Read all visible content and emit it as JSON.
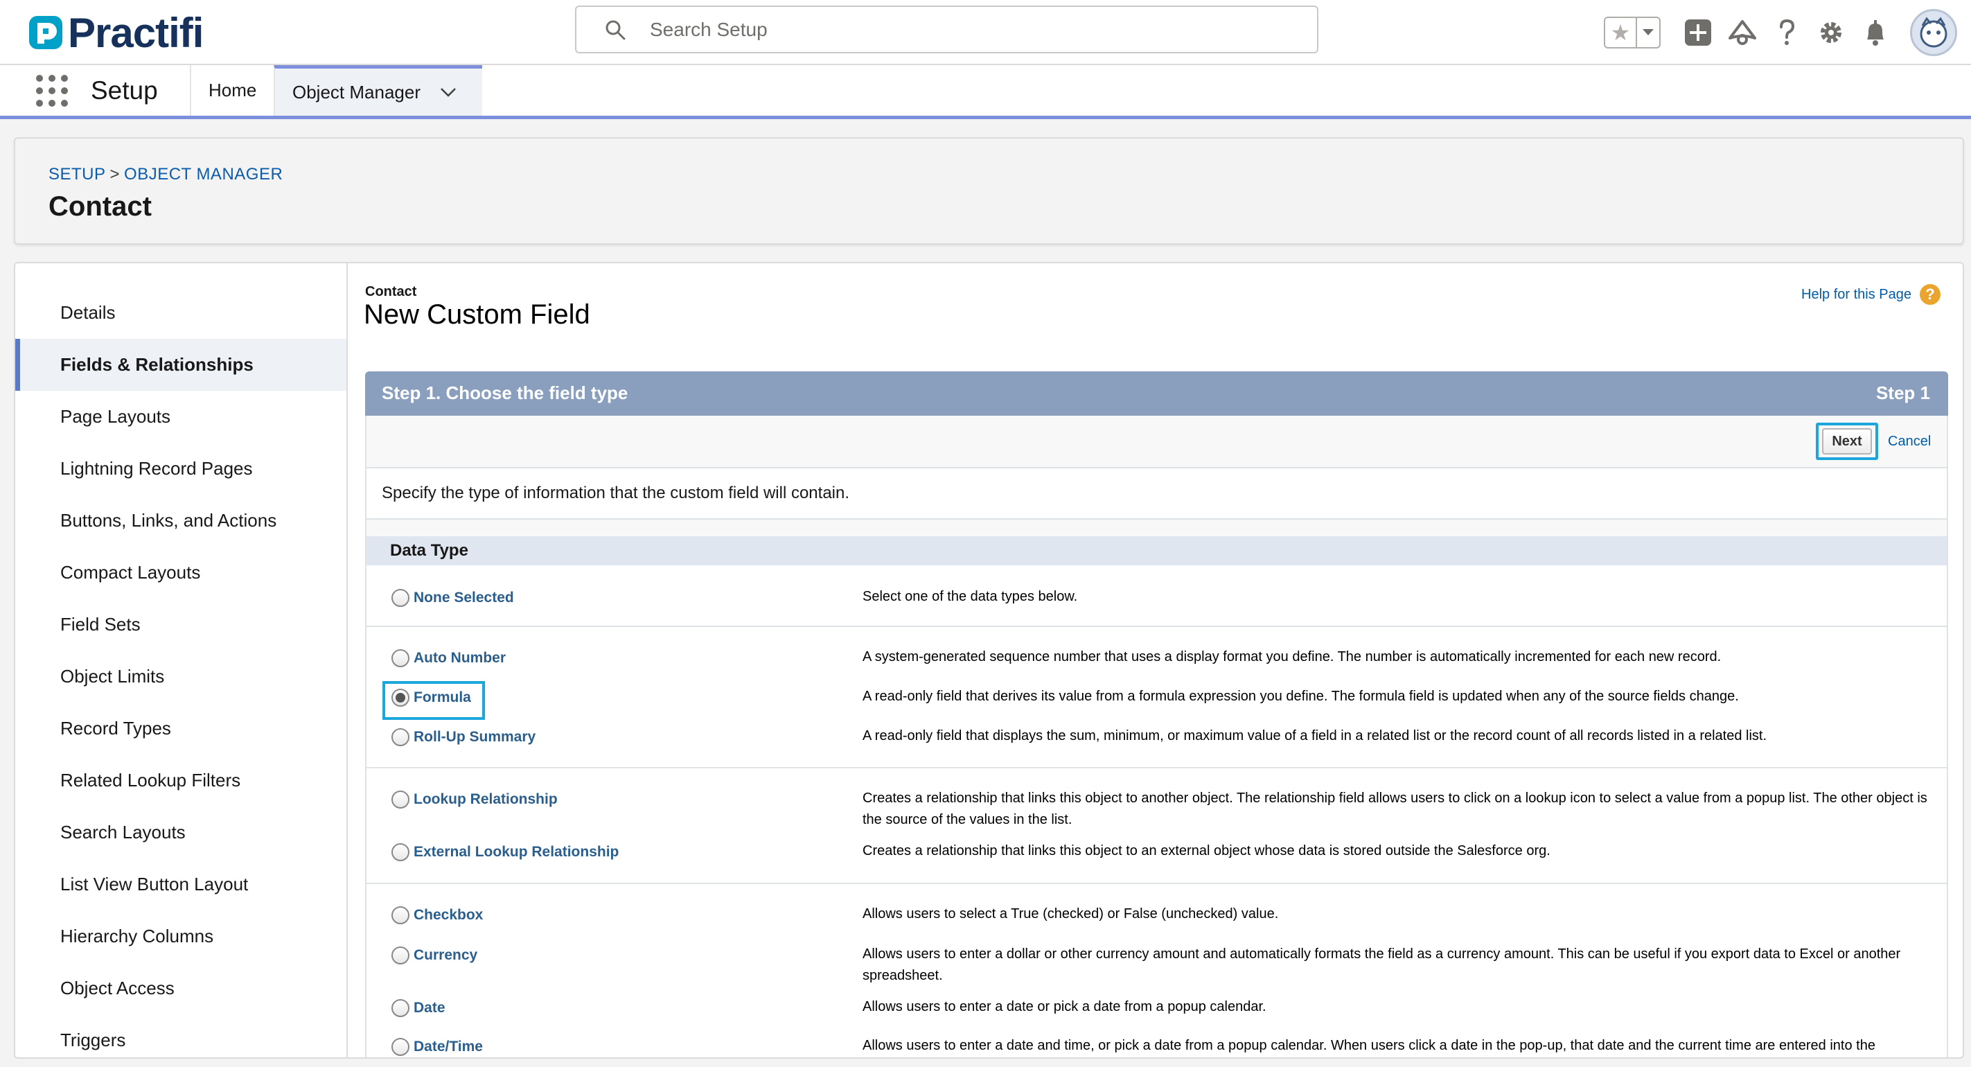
{
  "header": {
    "logo_text": "Practifi",
    "search_placeholder": "Search Setup",
    "icons": [
      "favorites-star-icon",
      "favorites-dropdown-icon",
      "add-icon",
      "trailhead-icon",
      "help-icon",
      "gear-icon",
      "bell-icon",
      "avatar"
    ]
  },
  "nav": {
    "app_name": "Setup",
    "tabs": [
      {
        "label": "Home",
        "active": false
      },
      {
        "label": "Object Manager",
        "active": true
      }
    ]
  },
  "page_header": {
    "breadcrumb": [
      "SETUP",
      "OBJECT MANAGER"
    ],
    "breadcrumb_sep": ">",
    "title": "Contact"
  },
  "sidebar": {
    "items": [
      {
        "label": "Details",
        "active": false
      },
      {
        "label": "Fields & Relationships",
        "active": true
      },
      {
        "label": "Page Layouts",
        "active": false
      },
      {
        "label": "Lightning Record Pages",
        "active": false
      },
      {
        "label": "Buttons, Links, and Actions",
        "active": false
      },
      {
        "label": "Compact Layouts",
        "active": false
      },
      {
        "label": "Field Sets",
        "active": false
      },
      {
        "label": "Object Limits",
        "active": false
      },
      {
        "label": "Record Types",
        "active": false
      },
      {
        "label": "Related Lookup Filters",
        "active": false
      },
      {
        "label": "Search Layouts",
        "active": false
      },
      {
        "label": "List View Button Layout",
        "active": false
      },
      {
        "label": "Hierarchy Columns",
        "active": false
      },
      {
        "label": "Object Access",
        "active": false
      },
      {
        "label": "Triggers",
        "active": false
      }
    ]
  },
  "content": {
    "object_label": "Contact",
    "title": "New Custom Field",
    "help_link": "Help for this Page",
    "help_badge": "?",
    "step_title": "Step 1. Choose the field type",
    "step_indicator": "Step 1",
    "next_label": "Next",
    "cancel_label": "Cancel",
    "instructions": "Specify the type of information that the custom field will contain.",
    "data_type_heading": "Data Type",
    "data_types": [
      {
        "label": "None Selected",
        "checked": false,
        "desc": "Select one of the data types below."
      },
      {
        "label": "Auto Number",
        "checked": false,
        "desc": "A system-generated sequence number that uses a display format you define. The number is automatically incremented for each new record."
      },
      {
        "label": "Formula",
        "checked": true,
        "desc": "A read-only field that derives its value from a formula expression you define. The formula field is updated when any of the source fields change."
      },
      {
        "label": "Roll-Up Summary",
        "checked": false,
        "desc": "A read-only field that displays the sum, minimum, or maximum value of a field in a related list or the record count of all records listed in a related list."
      },
      {
        "label": "Lookup Relationship",
        "checked": false,
        "desc": "Creates a relationship that links this object to another object. The relationship field allows users to click on a lookup icon to select a value from a popup list. The other object is the source of the values in the list."
      },
      {
        "label": "External Lookup Relationship",
        "checked": false,
        "desc": "Creates a relationship that links this object to an external object whose data is stored outside the Salesforce org."
      },
      {
        "label": "Checkbox",
        "checked": false,
        "desc": "Allows users to select a True (checked) or False (unchecked) value."
      },
      {
        "label": "Currency",
        "checked": false,
        "desc": "Allows users to enter a dollar or other currency amount and automatically formats the field as a currency amount. This can be useful if you export data to Excel or another spreadsheet."
      },
      {
        "label": "Date",
        "checked": false,
        "desc": "Allows users to enter a date or pick a date from a popup calendar."
      },
      {
        "label": "Date/Time",
        "checked": false,
        "desc": "Allows users to enter a date and time, or pick a date from a popup calendar. When users click a date in the pop-up, that date and the current time are entered into the"
      }
    ]
  }
}
